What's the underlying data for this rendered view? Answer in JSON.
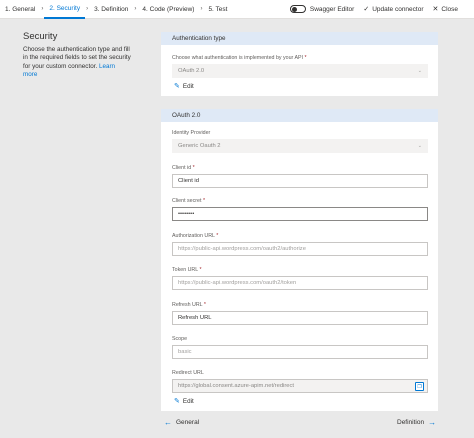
{
  "nav": {
    "steps": [
      {
        "label": "1. General"
      },
      {
        "label": "2. Security"
      },
      {
        "label": "3. Definition"
      },
      {
        "label": "4. Code (Preview)"
      },
      {
        "label": "5. Test"
      }
    ],
    "swagger_label": "Swagger Editor",
    "update_label": "Update connector",
    "close_label": "Close"
  },
  "info": {
    "title": "Security",
    "description": "Choose the authentication type and fill in the required fields to set the security for your custom connector.",
    "learn_more": "Learn more"
  },
  "auth_card": {
    "header": "Authentication type",
    "question": "Choose what authentication is implemented by your API",
    "question_required": "*",
    "value": "OAuth 2.0",
    "edit_label": "Edit"
  },
  "oauth_card": {
    "header": "OAuth 2.0",
    "identity_provider": {
      "label": "Identity Provider",
      "value": "Generic Oauth 2"
    },
    "client_id": {
      "label": "Client id",
      "required": "*",
      "value": "Client id"
    },
    "client_secret": {
      "label": "Client secret",
      "required": "*",
      "value": "••••••••"
    },
    "authorization_url": {
      "label": "Authorization URL",
      "required": "*",
      "placeholder": "https://public-api.wordpress.com/oauth2/authorize"
    },
    "token_url": {
      "label": "Token URL",
      "required": "*",
      "placeholder": "https://public-api.wordpress.com/oauth2/token"
    },
    "refresh_url": {
      "label": "Refresh URL",
      "required": "*",
      "value": "Refresh URL"
    },
    "scope": {
      "label": "Scope",
      "placeholder": "basic"
    },
    "redirect_url": {
      "label": "Redirect URL",
      "value": "https://global.consent.azure-apim.net/redirect"
    },
    "edit_label": "Edit"
  },
  "bottom_nav": {
    "back_label": "General",
    "next_label": "Definition"
  }
}
